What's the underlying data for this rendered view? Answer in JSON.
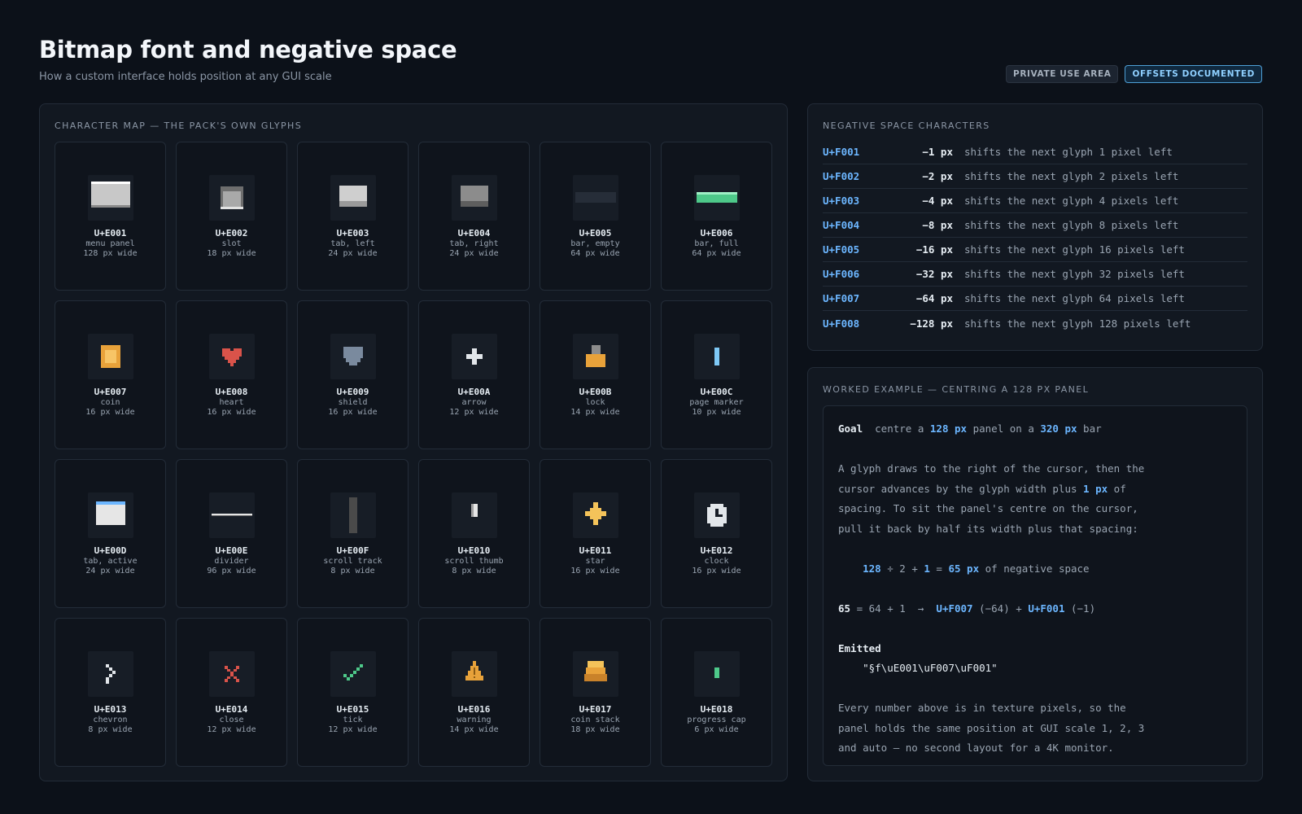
{
  "header": {
    "title": "Bitmap font and negative space",
    "subtitle": "How a custom interface holds position at any GUI scale",
    "badges": [
      "PRIVATE USE AREA",
      "OFFSETS DOCUMENTED"
    ]
  },
  "charmap": {
    "heading": "CHARACTER MAP — THE PACK'S OWN GLYPHS",
    "glyphs": [
      {
        "code": "U+E001",
        "name": "menu panel",
        "width": "128 px wide",
        "icon": "menu-panel-icon"
      },
      {
        "code": "U+E002",
        "name": "slot",
        "width": "18 px wide",
        "icon": "slot-icon"
      },
      {
        "code": "U+E003",
        "name": "tab, left",
        "width": "24 px wide",
        "icon": "tab-left-icon"
      },
      {
        "code": "U+E004",
        "name": "tab, right",
        "width": "24 px wide",
        "icon": "tab-right-icon"
      },
      {
        "code": "U+E005",
        "name": "bar, empty",
        "width": "64 px wide",
        "icon": "bar-empty-icon"
      },
      {
        "code": "U+E006",
        "name": "bar, full",
        "width": "64 px wide",
        "icon": "bar-full-icon"
      },
      {
        "code": "U+E007",
        "name": "coin",
        "width": "16 px wide",
        "icon": "coin-icon"
      },
      {
        "code": "U+E008",
        "name": "heart",
        "width": "16 px wide",
        "icon": "heart-icon"
      },
      {
        "code": "U+E009",
        "name": "shield",
        "width": "16 px wide",
        "icon": "shield-icon"
      },
      {
        "code": "U+E00A",
        "name": "arrow",
        "width": "12 px wide",
        "icon": "arrow-icon"
      },
      {
        "code": "U+E00B",
        "name": "lock",
        "width": "14 px wide",
        "icon": "lock-icon"
      },
      {
        "code": "U+E00C",
        "name": "page marker",
        "width": "10 px wide",
        "icon": "page-marker-icon"
      },
      {
        "code": "U+E00D",
        "name": "tab, active",
        "width": "24 px wide",
        "icon": "tab-active-icon"
      },
      {
        "code": "U+E00E",
        "name": "divider",
        "width": "96 px wide",
        "icon": "divider-icon"
      },
      {
        "code": "U+E00F",
        "name": "scroll track",
        "width": "8 px wide",
        "icon": "scroll-track-icon"
      },
      {
        "code": "U+E010",
        "name": "scroll thumb",
        "width": "8 px wide",
        "icon": "scroll-thumb-icon"
      },
      {
        "code": "U+E011",
        "name": "star",
        "width": "16 px wide",
        "icon": "star-icon"
      },
      {
        "code": "U+E012",
        "name": "clock",
        "width": "16 px wide",
        "icon": "clock-icon"
      },
      {
        "code": "U+E013",
        "name": "chevron",
        "width": "8 px wide",
        "icon": "chevron-icon"
      },
      {
        "code": "U+E014",
        "name": "close",
        "width": "12 px wide",
        "icon": "close-icon"
      },
      {
        "code": "U+E015",
        "name": "tick",
        "width": "12 px wide",
        "icon": "tick-icon"
      },
      {
        "code": "U+E016",
        "name": "warning",
        "width": "14 px wide",
        "icon": "warning-icon"
      },
      {
        "code": "U+E017",
        "name": "coin stack",
        "width": "18 px wide",
        "icon": "coin-stack-icon"
      },
      {
        "code": "U+E018",
        "name": "progress cap",
        "width": "6 px wide",
        "icon": "progress-cap-icon"
      }
    ]
  },
  "negative_space": {
    "heading": "NEGATIVE SPACE CHARACTERS",
    "rows": [
      {
        "code": "U+F001",
        "px": "−1 px",
        "desc": "shifts the next glyph 1 pixel left"
      },
      {
        "code": "U+F002",
        "px": "−2 px",
        "desc": "shifts the next glyph 2 pixels left"
      },
      {
        "code": "U+F003",
        "px": "−4 px",
        "desc": "shifts the next glyph 4 pixels left"
      },
      {
        "code": "U+F004",
        "px": "−8 px",
        "desc": "shifts the next glyph 8 pixels left"
      },
      {
        "code": "U+F005",
        "px": "−16 px",
        "desc": "shifts the next glyph 16 pixels left"
      },
      {
        "code": "U+F006",
        "px": "−32 px",
        "desc": "shifts the next glyph 32 pixels left"
      },
      {
        "code": "U+F007",
        "px": "−64 px",
        "desc": "shifts the next glyph 64 pixels left"
      },
      {
        "code": "U+F008",
        "px": "−128 px",
        "desc": "shifts the next glyph 128 pixels left"
      }
    ]
  },
  "worked": {
    "heading": "WORKED EXAMPLE — CENTRING A 128 PX PANEL",
    "goal_label": "Goal",
    "goal_a": "  centre a ",
    "goal_b": "128 px",
    "goal_c": " panel on a ",
    "goal_d": "320 px",
    "goal_e": " bar",
    "p1_l1": "A glyph draws to the right of the cursor, then the",
    "p1_l2a": "cursor advances by the glyph width plus ",
    "p1_l2b": "1 px",
    "p1_l2c": " of",
    "p1_l3": "spacing. To sit the panel's centre on the cursor,",
    "p1_l4": "pull it back by half its width plus that spacing:",
    "calc_a": "    ",
    "calc_b": "128",
    "calc_c": " ÷ 2 + ",
    "calc_d": "1",
    "calc_e": " = ",
    "calc_f": "65 px",
    "calc_g": " of negative space",
    "eq_a": "65",
    "eq_b": " = 64 + 1  →  ",
    "eq_c": "U+F007",
    "eq_d": " (−64) + ",
    "eq_e": "U+F001",
    "eq_f": " (−1)",
    "emitted_label": "Emitted",
    "emitted_value": "    \"§f\\uE001\\uF007\\uF001\"",
    "p2_l1": "Every number above is in texture pixels, so the",
    "p2_l2": "panel holds the same position at GUI scale 1, 2, 3",
    "p2_l3": "and auto — no second layout for a 4K monitor."
  }
}
